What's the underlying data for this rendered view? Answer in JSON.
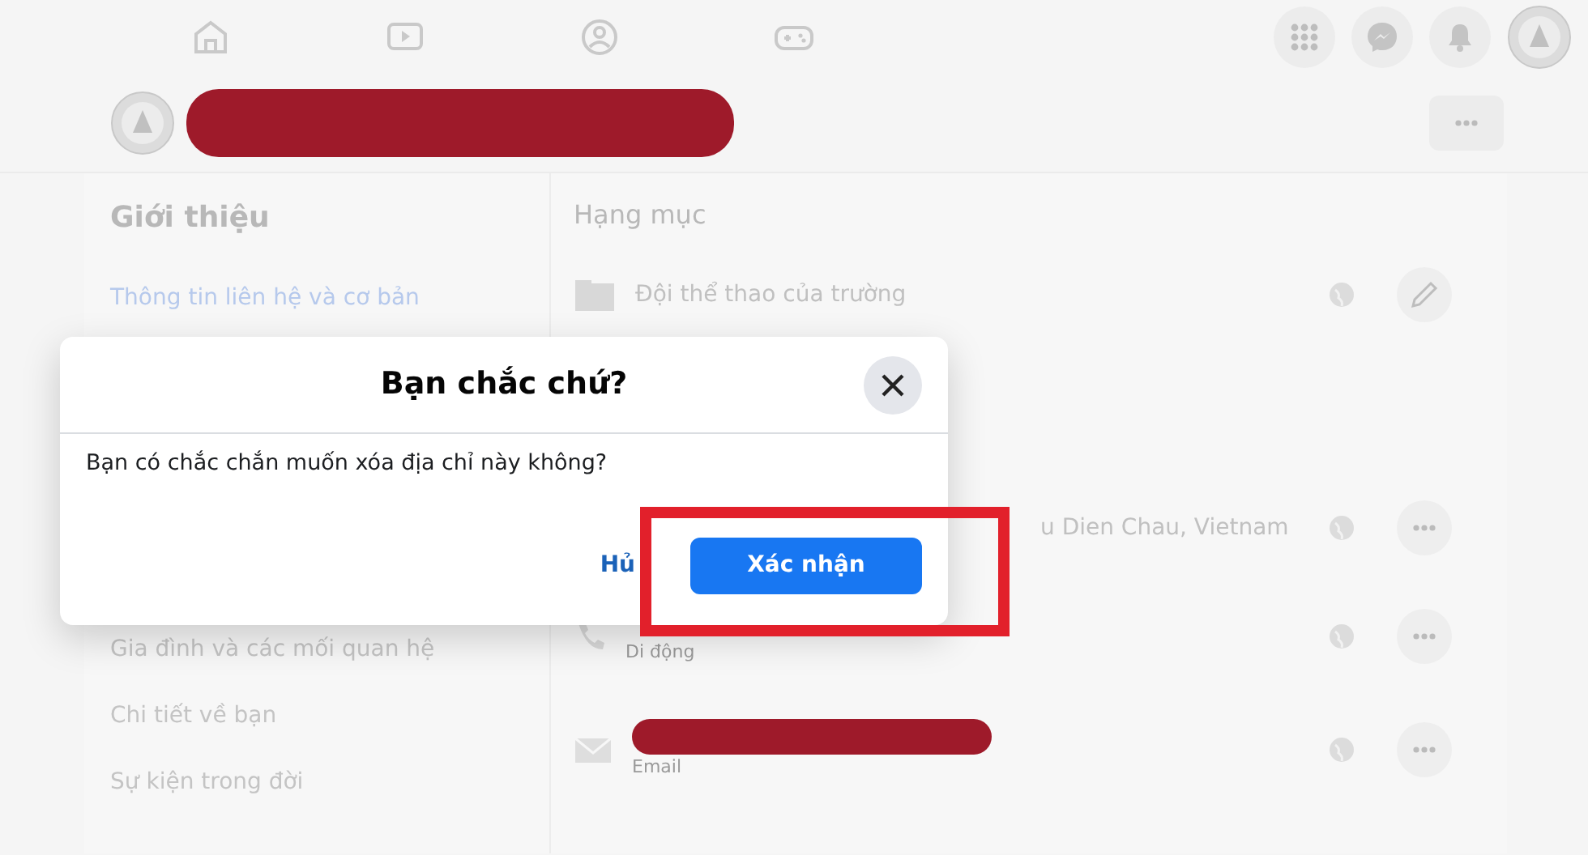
{
  "about": {
    "title": "Giới thiệu",
    "menu": [
      {
        "label": "Thông tin liên hệ và cơ bản",
        "selected": true
      },
      {
        "label": "Gia đình và các mối quan hệ",
        "selected": false
      },
      {
        "label": "Chi tiết về bạn",
        "selected": false
      },
      {
        "label": "Sự kiện trong đời",
        "selected": false
      }
    ]
  },
  "details": {
    "heading": "Hạng mục",
    "rows": [
      {
        "kind": "category",
        "text": "Đội thể thao của trường"
      },
      {
        "kind": "address",
        "text": "u Dien Chau, Vietnam"
      },
      {
        "kind": "phone",
        "sub": "Di động"
      },
      {
        "kind": "email",
        "sub": "Email"
      }
    ]
  },
  "dialog": {
    "title": "Bạn chắc chứ?",
    "message": "Bạn có chắc chắn muốn xóa địa chỉ này không?",
    "cancel": "Hủ",
    "confirm": "Xác nhận"
  }
}
